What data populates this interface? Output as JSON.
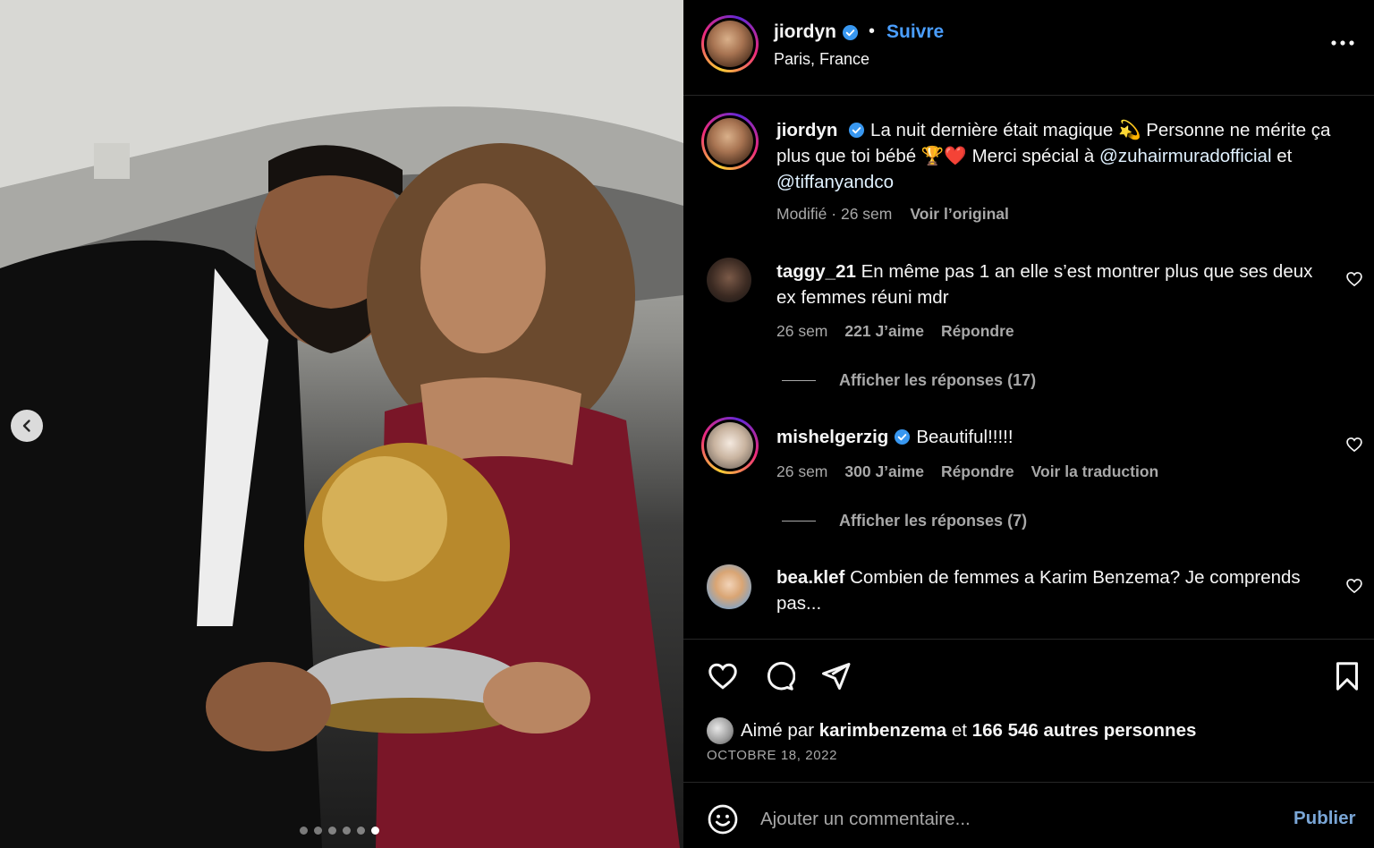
{
  "post": {
    "username": "jiordyn",
    "follow_label": "Suivre",
    "separator": "•",
    "location": "Paris, France",
    "more_icon": "more-horizontal-icon",
    "verified_color": "#3897f0"
  },
  "caption": {
    "username": "jiordyn",
    "text_before": "La nuit dernière était magique 💫 Personne ne mérite ça plus que toi bébé 🏆❤️ Merci spécial à ",
    "mention_1": "@zuhairmuradofficial",
    "conjunction": " et ",
    "mention_2": "@tiffanyandco",
    "edited_label": "Modifié",
    "dot": " · ",
    "time": "26 sem",
    "see_original": "Voir l’original"
  },
  "comments": [
    {
      "username": "taggy_21",
      "verified": false,
      "text": "En même pas 1 an elle s’est montrer plus que ses deux ex femmes réuni mdr",
      "time": "26 sem",
      "likes": "221 J’aime",
      "reply": "Répondre",
      "replies_label": "Afficher les réponses (17)"
    },
    {
      "username": "mishelgerzig",
      "verified": true,
      "text": "Beautiful!!!!!",
      "time": "26 sem",
      "likes": "300 J’aime",
      "reply": "Répondre",
      "translate": "Voir la traduction",
      "replies_label": "Afficher les réponses (7)"
    },
    {
      "username": "bea.klef",
      "verified": false,
      "text": "Combien de femmes a Karim Benzema? Je comprends pas..."
    }
  ],
  "footer": {
    "liked_by_prefix": "Aimé par ",
    "liked_by_user": "karimbenzema",
    "liked_by_mid": " et ",
    "liked_by_count": "166 546 autres personnes",
    "date": "OCTOBRE 18, 2022",
    "comment_placeholder": "Ajouter un commentaire...",
    "publish_label": "Publier"
  },
  "carousel": {
    "slide_count": 6,
    "active_index": 5
  }
}
